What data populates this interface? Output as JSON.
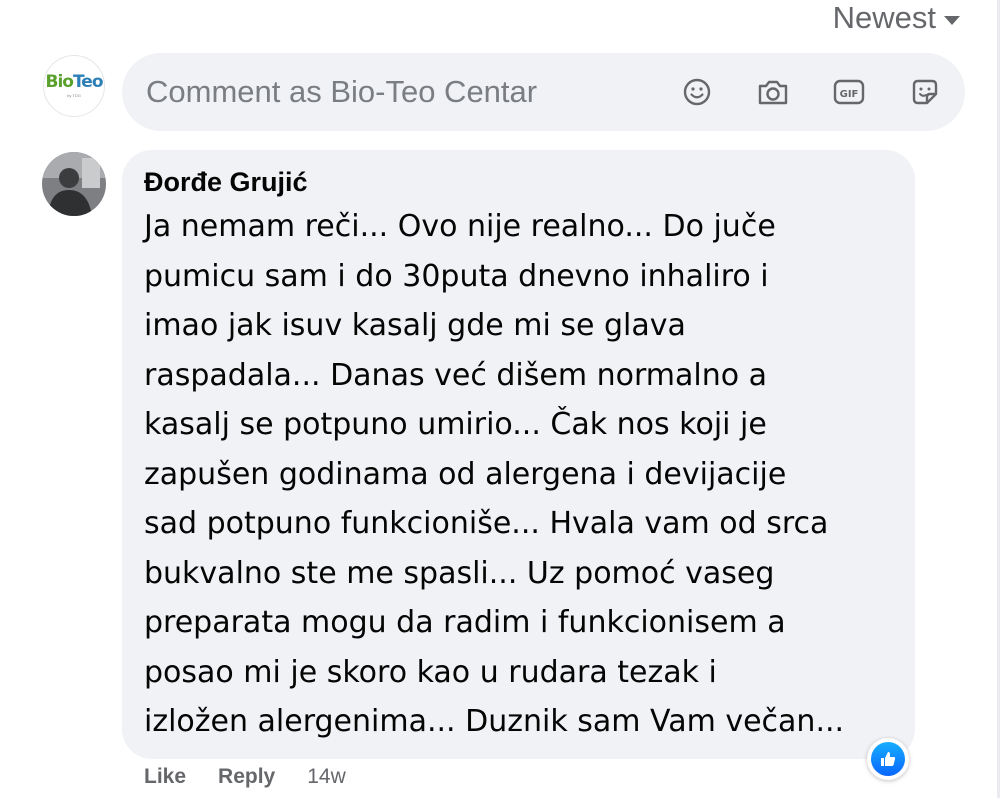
{
  "sort": {
    "label": "Newest"
  },
  "page": {
    "logo_bio": "Bio",
    "logo_teo": "Teo",
    "logo_sub": "by TDG"
  },
  "composer": {
    "placeholder": "Comment as Bio-Teo Centar",
    "tools": [
      "emoji-icon",
      "camera-icon",
      "gif-icon",
      "sticker-icon"
    ]
  },
  "comment": {
    "author": "Đorđe Grujić",
    "text": "Ja nemam reči... Ovo nije realno... Do juče\npumicu sam i do 30puta dnevno inhaliro i\nimao jak isuv kasalj gde mi se glava\nraspadala... Danas već dišem normalno a\nkasalj se potpuno umirio... Čak nos koji je\nzapušen godinama od alergena i devijacije\nsad potpuno funkcioniše... Hvala vam od srca\nbukvalno ste me spasli... Uz pomoć vaseg\npreparata mogu da radim i funkcionisem a\nposao mi je skoro kao u rudara tezak i\nizložen alergenima... Duznik sam Vam večan...",
    "reaction": "like",
    "like_label": "Like",
    "reply_label": "Reply",
    "time": "14w"
  },
  "colors": {
    "bubble": "#f0f2f5",
    "secondary_text": "#65676b",
    "like_blue": "#0866ff"
  }
}
